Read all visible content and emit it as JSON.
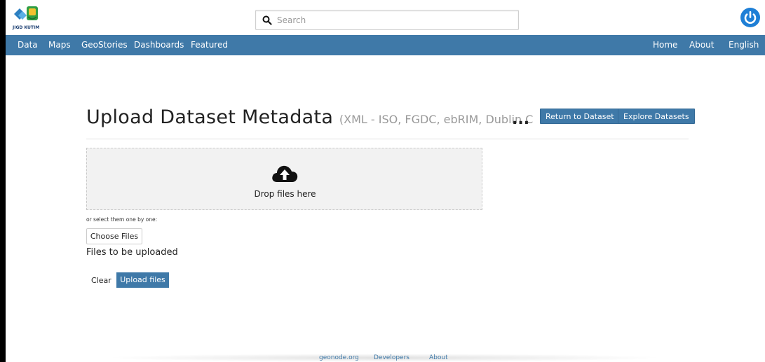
{
  "header": {
    "logo_text": "JIGD KUTIM",
    "search_placeholder": "Search"
  },
  "nav": {
    "left": [
      "Data",
      "Maps",
      "GeoStories",
      "Dashboards",
      "Featured"
    ],
    "right": [
      "Home",
      "About",
      "English"
    ]
  },
  "main": {
    "title": "Upload Dataset Metadata",
    "subtitle": "(XML - ISO, FGDC, ebRIM, Dublin C",
    "ellipsis": "...",
    "return_button": "Return to Dataset",
    "explore_button": "Explore Datasets",
    "drop_text": "Drop files here",
    "select_hint": "or select them one by one:",
    "choose_button": "Choose Files",
    "files_label": "Files to be uploaded",
    "clear_button": "Clear",
    "upload_button": "Upload files"
  },
  "footer": {
    "links": [
      "geonode.org",
      "Developers",
      "About"
    ]
  },
  "colors": {
    "brand": "#3f79a8",
    "power": "#1e7fd6"
  }
}
